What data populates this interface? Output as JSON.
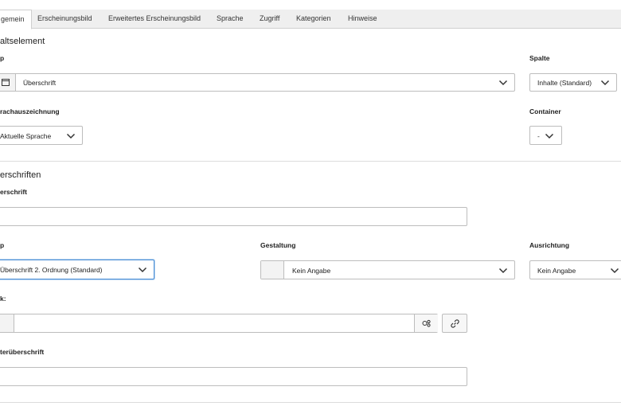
{
  "tabs": [
    {
      "label": "gemein"
    },
    {
      "label": "Erscheinungsbild"
    },
    {
      "label": "Erweitertes Erscheinungsbild"
    },
    {
      "label": "Sprache"
    },
    {
      "label": "Zugriff"
    },
    {
      "label": "Kategorien"
    },
    {
      "label": "Hinweise"
    }
  ],
  "content_element": {
    "section_title": "altselement",
    "type_label": "p",
    "type_value": "Überschrift",
    "column_label": "Spalte",
    "column_value": "Inhalte (Standard)",
    "language_label": "rachauszeichnung",
    "language_value": "Aktuelle Sprache",
    "container_label": "Container",
    "container_value": "-"
  },
  "headings": {
    "section_title": "erschriften",
    "heading_label": "erschrift",
    "heading_value": "",
    "type_label": "p",
    "type_value": "Überschrift 2. Ordnung (Standard)",
    "design_label": "Gestaltung",
    "design_value": "Kein Angabe",
    "align_label": "Ausrichtung",
    "align_value": "Kein Angabe",
    "link_label": "k:",
    "link_value": "",
    "subheading_label": "terüberschrift",
    "subheading_value": ""
  },
  "icons": {
    "content_type": "content-element-icon",
    "link_picker": "link-browser-icon",
    "link": "link-icon"
  }
}
